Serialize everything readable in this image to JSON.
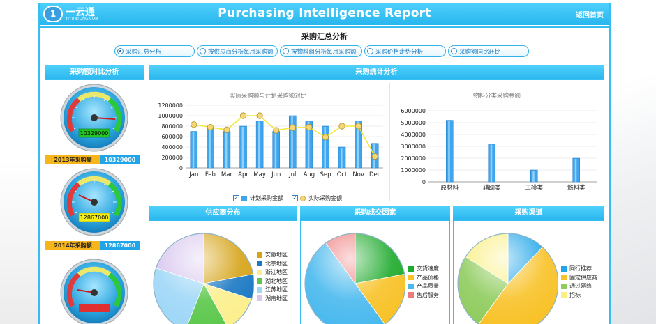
{
  "header": {
    "logo_mark": "1",
    "logo_name": "一云通",
    "logo_url": "YIYUNTONG.COM",
    "title": "Purchasing Intelligence Report",
    "home_link": "返回首页"
  },
  "section_title": "采购汇总分析",
  "tabs": [
    {
      "label": "采购汇总分析",
      "selected": true
    },
    {
      "label": "按供应商分析每月采购额",
      "selected": false
    },
    {
      "label": "按物料组分析每月采购额",
      "selected": false
    },
    {
      "label": "采购价格走势分析",
      "selected": false
    },
    {
      "label": "采购额同比环比",
      "selected": false
    }
  ],
  "left_panel": {
    "title": "采购额对比分析",
    "gauges": [
      {
        "year_label": "2013年采购额",
        "value": "10329000",
        "display": "10329000",
        "display_color": "#22c522"
      },
      {
        "year_label": "2014年采购额",
        "value": "12867000",
        "display": "12867000",
        "display_color": "#f2ee1a"
      },
      {
        "display_color": "#e03030"
      }
    ]
  },
  "stats_panel": {
    "title": "采购统计分析"
  },
  "charts": {
    "supplier_title": "供应商分布",
    "factors_title": "采购成交因素",
    "channel_title": "采购渠道"
  },
  "chart_data": [
    {
      "type": "bar",
      "title": "实际采购额与计划采购额对比",
      "categories": [
        "Jan",
        "Feb",
        "Mar",
        "Apr",
        "May",
        "Jun",
        "Jul",
        "Aug",
        "Sep",
        "Oct",
        "Nov",
        "Dec"
      ],
      "series": [
        {
          "name": "计划采购金额",
          "type": "bar",
          "values": [
            700000,
            750000,
            700000,
            800000,
            900000,
            700000,
            1000000,
            900000,
            800000,
            400000,
            900000,
            470000
          ]
        },
        {
          "name": "实际采购金额",
          "type": "line",
          "values": [
            830000,
            780000,
            730000,
            1000000,
            1000000,
            720000,
            770000,
            780000,
            590000,
            800000,
            800000,
            220000
          ]
        }
      ],
      "ylim": [
        0,
        1200000
      ],
      "yticks": [
        "0",
        "200000",
        "400000",
        "600000",
        "800000",
        "1000000",
        "1200000"
      ],
      "legend_position": "bottom",
      "colors": {
        "bar": "#3fa6ee",
        "line": "#f3e73a",
        "point": "#f5d77a"
      }
    },
    {
      "type": "bar",
      "title": "物料分类采购金额",
      "categories": [
        "原材料",
        "辅助类",
        "工模类",
        "燃料类"
      ],
      "values": [
        5200000,
        3200000,
        1000000,
        2000000
      ],
      "ylim": [
        0,
        6000000
      ],
      "yticks": [
        "0",
        "1000000",
        "2000000",
        "3000000",
        "4000000",
        "5000000",
        "6000000"
      ],
      "colors": {
        "bar": "#3fa6ee"
      }
    },
    {
      "type": "pie",
      "title": "供应商分布",
      "labels": [
        "安徽地区",
        "北京地区",
        "浙江地区",
        "湖北地区",
        "江苏地区",
        "湖南地区"
      ],
      "values": [
        22,
        8,
        12,
        14,
        24,
        20
      ],
      "colors": [
        "#d6a316",
        "#1b79c4",
        "#fcef8e",
        "#5cc84c",
        "#9fd7f7",
        "#d8c6ef"
      ]
    },
    {
      "type": "pie",
      "title": "采购成交因素",
      "labels": [
        "交货速度",
        "产品价格",
        "产品质量",
        "售后服务"
      ],
      "values": [
        22,
        18,
        50,
        10
      ],
      "colors": [
        "#1eaa2c",
        "#f8c228",
        "#49b9ee",
        "#ef7b7b"
      ]
    },
    {
      "type": "pie",
      "title": "采购渠道",
      "labels": [
        "同行推荐",
        "固定供应商",
        "通过网络",
        "招标"
      ],
      "values": [
        12,
        48,
        24,
        16
      ],
      "colors": [
        "#1fa5e8",
        "#f8c228",
        "#8fcc5e",
        "#fbef82"
      ]
    }
  ]
}
